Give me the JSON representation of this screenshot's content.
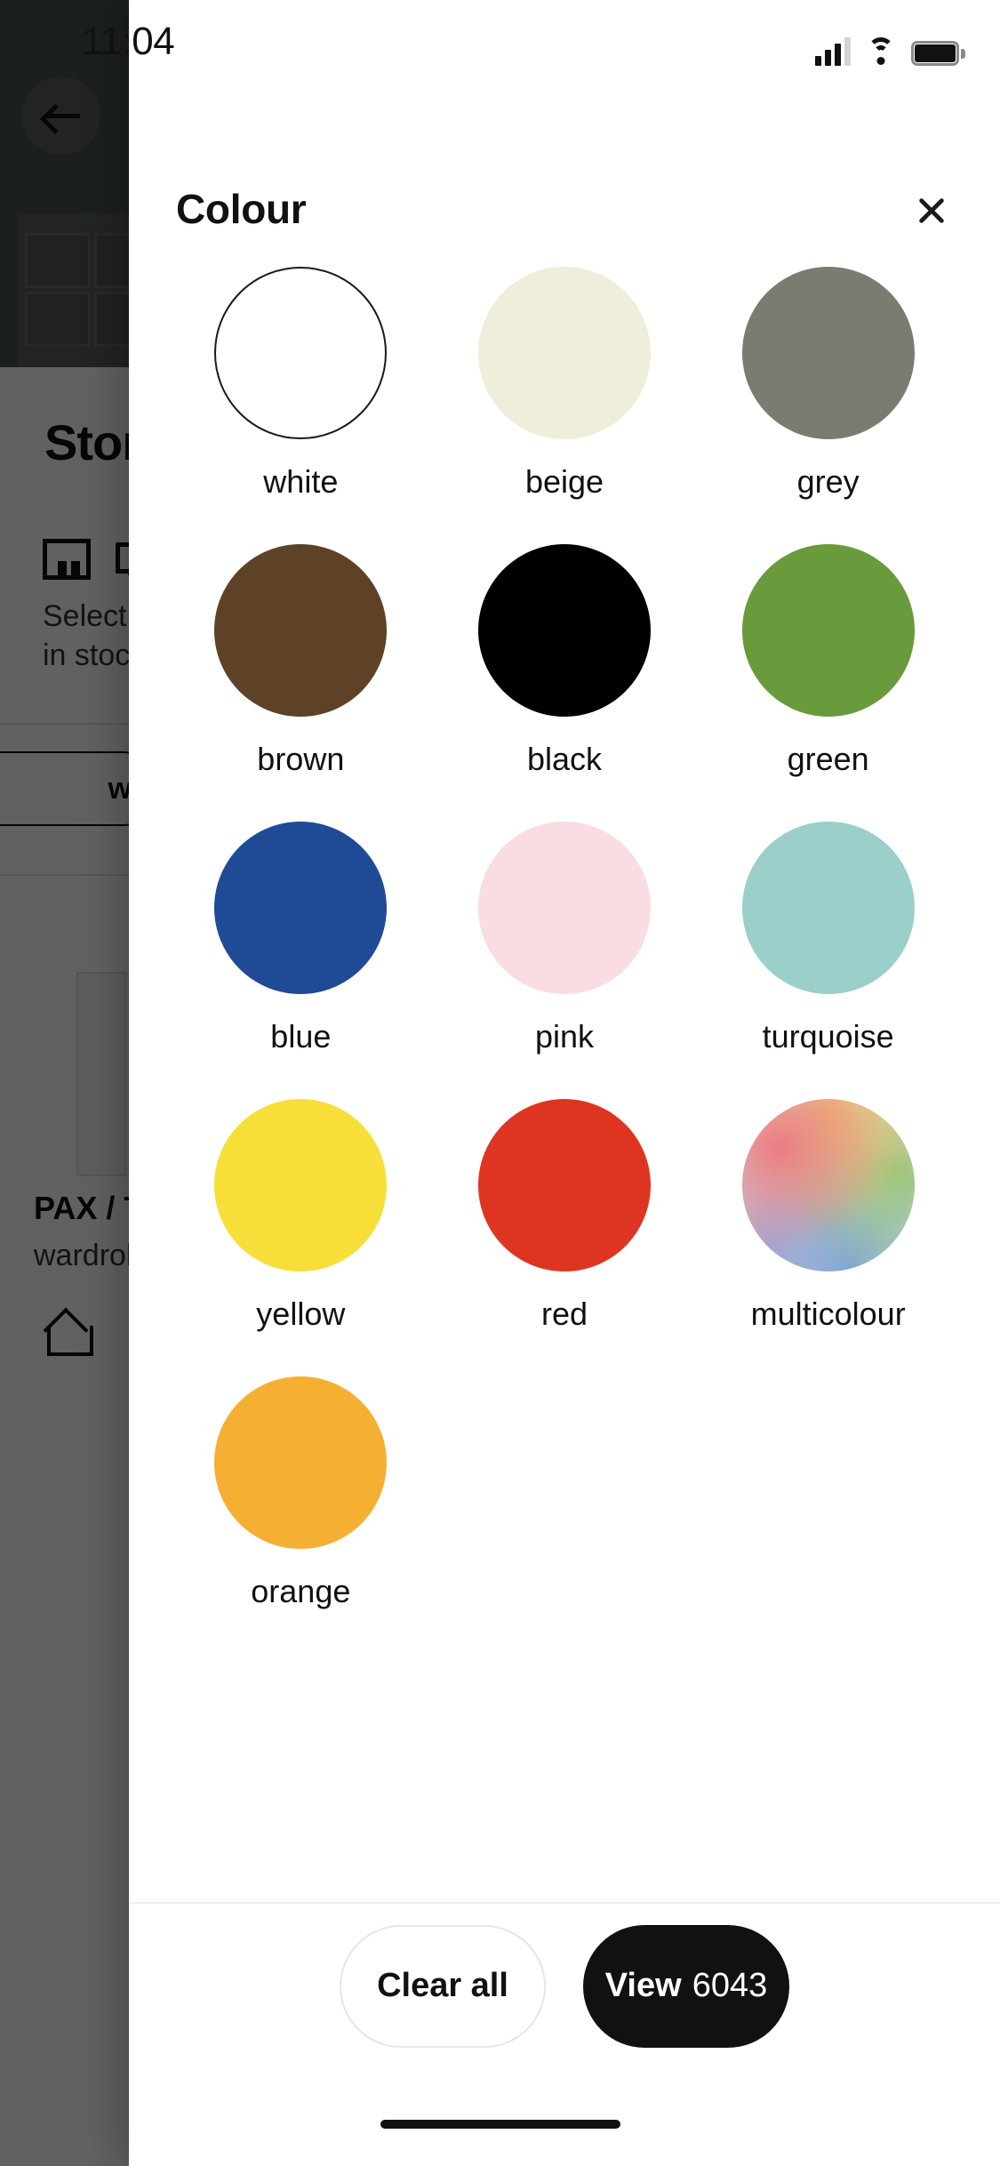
{
  "status_bar": {
    "time": "11:04",
    "signal_icon": "cellular-signal-icon",
    "wifi_icon": "wifi-icon",
    "battery_icon": "battery-icon"
  },
  "background_page": {
    "back_icon": "back-arrow-icon",
    "title": "Stor",
    "store_icon": "store-icon",
    "delivery_icon": "delivery-truck-icon",
    "availability_line1": "Select st",
    "availability_line2": "in stock",
    "pill_label": "w",
    "product_name": "PAX / TY",
    "product_desc": "wardrob",
    "home_icon": "home-icon"
  },
  "sheet": {
    "title": "Colour",
    "close_icon": "close-icon",
    "colours": [
      {
        "name": "white",
        "hex": "#ffffff",
        "outlined": true
      },
      {
        "name": "beige",
        "hex": "#eeeedb",
        "outlined": false
      },
      {
        "name": "grey",
        "hex": "#7b7b72",
        "outlined": false
      },
      {
        "name": "brown",
        "hex": "#5d4228",
        "outlined": false
      },
      {
        "name": "black",
        "hex": "#000000",
        "outlined": false
      },
      {
        "name": "green",
        "hex": "#699a3c",
        "outlined": false
      },
      {
        "name": "blue",
        "hex": "#1f4b96",
        "outlined": false
      },
      {
        "name": "pink",
        "hex": "#fadce3",
        "outlined": false
      },
      {
        "name": "turquoise",
        "hex": "#9bcfc9",
        "outlined": false
      },
      {
        "name": "yellow",
        "hex": "#f8de39",
        "outlined": false
      },
      {
        "name": "red",
        "hex": "#dd3521",
        "outlined": false
      },
      {
        "name": "multicolour",
        "hex": "multicolour-gradient",
        "outlined": false
      },
      {
        "name": "orange",
        "hex": "#f5b033",
        "outlined": false
      }
    ],
    "footer": {
      "clear_label": "Clear all",
      "view_label": "View",
      "view_count": "6043"
    }
  }
}
